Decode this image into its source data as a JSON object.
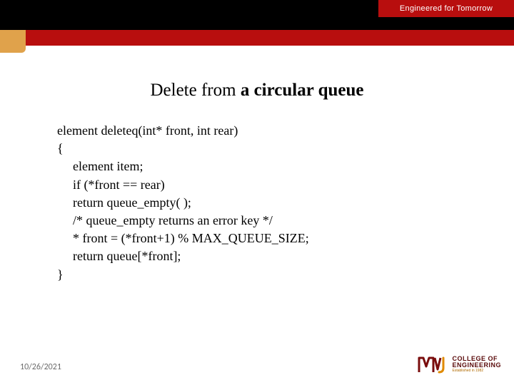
{
  "header": {
    "tagline": "Engineered for Tomorrow"
  },
  "title_prefix": "Delete from ",
  "title_bold": "a circular queue",
  "code": {
    "l1": "element deleteq(int* front, int rear)",
    "l2": "{",
    "l3": "element item;",
    "l4": "if (*front == rear)",
    "l5": "return queue_empty( );",
    "l6": "/* queue_empty returns an error key */",
    "l7": "* front = (*front+1) % MAX_QUEUE_SIZE;",
    "l8": "return queue[*front];",
    "l9": "}"
  },
  "footer": {
    "date": "10/26/2021",
    "logo_line1": "COLLEGE OF",
    "logo_line2": "ENGINEERING",
    "logo_line3": "Established in 1982"
  }
}
